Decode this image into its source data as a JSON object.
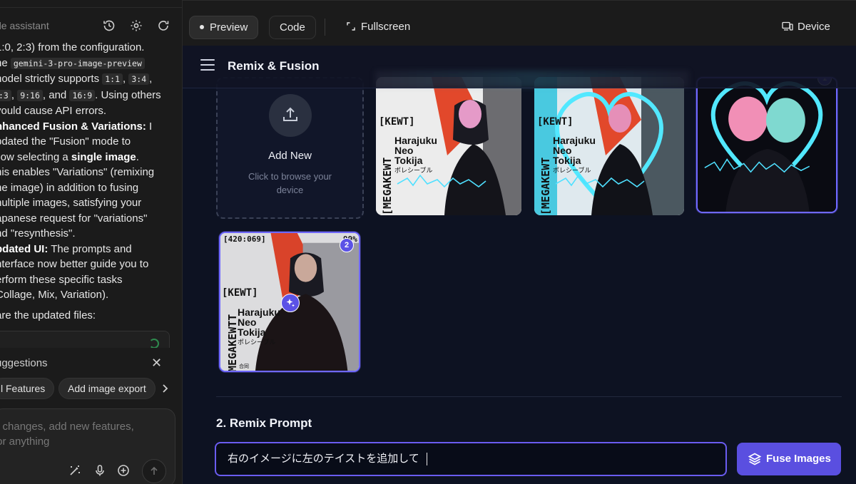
{
  "left_panel": {
    "assistant_title": "de assistant",
    "chat_lines": {
      "l1": "1:0, 2:3) from the configuration.",
      "l2a": "he ",
      "code_model": "gemini-3-pro-image-preview",
      "l3a": "nodel strictly supports ",
      "code_11": "1:1",
      "code_34": "3:4",
      "code_43": ":3",
      "code_916": "9:16",
      "l4b": ", and ",
      "code_169": "16:9",
      "l4c": ". Using others",
      "l5": "vould cause API errors.",
      "fusion_heading": "nhanced Fusion & Variations:",
      "fusion_a": " I",
      "fusion_b": "pdated the \"Fusion\" mode to",
      "fusion_c": "llow selecting a ",
      "fusion_bold": "single image",
      "fusion_d": ".",
      "fusion_e": "his enables \"Variations\" (remixing",
      "fusion_f": "ne image) in addition to fusing",
      "fusion_g": "nultiple images, satisfying your",
      "fusion_h": "apanese request for \"variations\"",
      "fusion_i": "nd \"resynthesis\".",
      "ui_heading": "pdated UI:",
      "ui_a": " The prompts and",
      "ui_b": "nterface now better guide you to",
      "ui_c": "erform these specific tasks",
      "ui_d": "Collage, Mix, Variation).",
      "files_line": " are the updated files:"
    },
    "suggestions": {
      "title": "uggestions",
      "chips": [
        "l Features",
        "Add image export"
      ]
    },
    "composer": {
      "placeholder_l1": "e changes, add new features,",
      "placeholder_l2": "for anything"
    }
  },
  "toolbar": {
    "preview_label": "Preview",
    "code_label": "Code",
    "fullscreen_label": "Fullscreen",
    "device_label": "Device"
  },
  "app": {
    "title": "Remix & Fusion",
    "add_new": {
      "title": "Add New",
      "subtitle": "Click to browse your device"
    },
    "images": [
      {
        "header_left": "[KEWT]",
        "side_text": "[MEGAKEWT",
        "title_1": "Harajuku",
        "title_2": "Neo",
        "title_3": "Tokija",
        "sub": "ポレシーブル",
        "selected": false,
        "tint": "#4fe0ff"
      },
      {
        "header_left": "[KEWT]",
        "side_text": "[MEGAKEWT",
        "title_1": "Harajuku",
        "title_2": "Neo",
        "title_3": "Tokija",
        "sub": "ポレシーブル",
        "selected": false,
        "tint": "#4fe0ff"
      },
      {
        "header_left": "",
        "side_text": "",
        "title_1": "",
        "title_2": "",
        "title_3": "",
        "sub": "",
        "selected": true,
        "badge": "1",
        "tint": "#4fe0ff"
      },
      {
        "header_left": "[KEWT]",
        "corner_text": "[420:069]",
        "percent": "99%",
        "side_text": "[MEGAKEWTT",
        "title_1": "Harajuku",
        "title_2": "Neo",
        "title_3": "Tokija",
        "sub": "ポレシーブル",
        "small": "合同",
        "selected": true,
        "badge": "2"
      }
    ],
    "section_label": "2. Remix Prompt",
    "prompt_value": "右のイメージに左のテイストを追加して",
    "fuse_label": "Fuse Images"
  },
  "colors": {
    "accent": "#5a4fe0",
    "app_bg": "#0d1222",
    "panel_bg": "#1b1b1b"
  }
}
